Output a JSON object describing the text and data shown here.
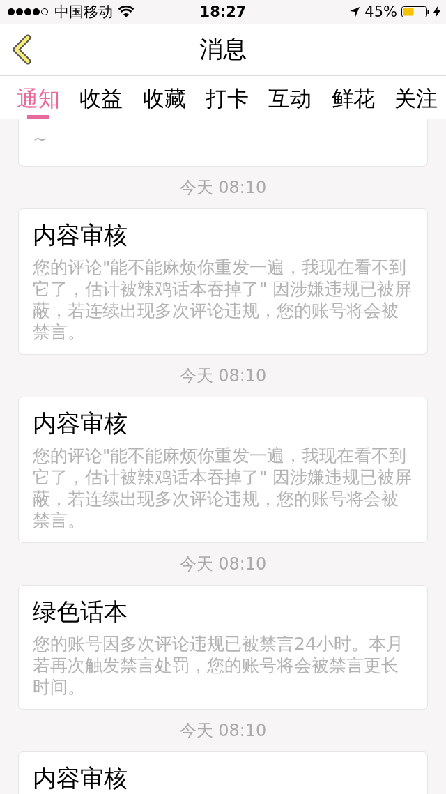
{
  "status_bar": {
    "carrier": "中国移动",
    "time": "18:27",
    "battery": "45%"
  },
  "nav": {
    "title": "消息"
  },
  "tabs": [
    {
      "label": "通知",
      "selected": true
    },
    {
      "label": "收益",
      "selected": false
    },
    {
      "label": "收藏",
      "selected": false
    },
    {
      "label": "打卡",
      "selected": false
    },
    {
      "label": "互动",
      "selected": false
    },
    {
      "label": "鲜花",
      "selected": false
    },
    {
      "label": "关注",
      "selected": false
    }
  ],
  "feed": [
    {
      "kind": "tail",
      "body": "~"
    },
    {
      "kind": "time",
      "text": "今天 08:10"
    },
    {
      "kind": "card",
      "title": "内容审核",
      "body": "您的评论\"能不能麻烦你重发一遍，我现在看不到它了，估计被辣鸡话本吞掉了\" 因涉嫌违规已被屏蔽，若连续出现多次评论违规，您的账号将会被禁言。"
    },
    {
      "kind": "time",
      "text": "今天 08:10"
    },
    {
      "kind": "card",
      "title": "内容审核",
      "body": "您的评论\"能不能麻烦你重发一遍，我现在看不到它了，估计被辣鸡话本吞掉了\" 因涉嫌违规已被屏蔽，若连续出现多次评论违规，您的账号将会被禁言。"
    },
    {
      "kind": "time",
      "text": "今天 08:10"
    },
    {
      "kind": "card",
      "title": "绿色话本",
      "body": "您的账号因多次评论违规已被禁言24小时。本月若再次触发禁言处罚，您的账号将会被禁言更长时间。"
    },
    {
      "kind": "time",
      "text": "今天 08:10"
    },
    {
      "kind": "card",
      "title": "内容审核"
    }
  ]
}
